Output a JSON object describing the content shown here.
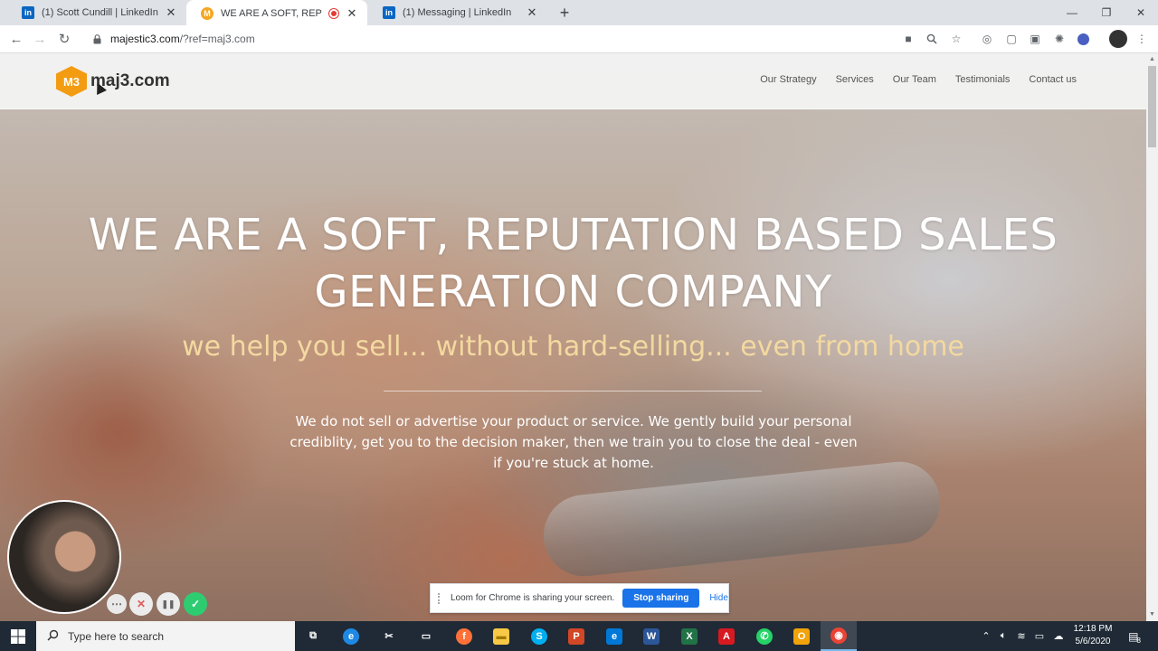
{
  "browser": {
    "tabs": [
      {
        "title": "(1) Scott Cundill | LinkedIn",
        "favicon": "linkedin-icon",
        "active": false
      },
      {
        "title": "WE ARE A SOFT, REPUTATIO",
        "favicon": "maj3-icon",
        "active": true,
        "recording": true
      },
      {
        "title": "(1) Messaging | LinkedIn",
        "favicon": "linkedin-icon",
        "active": false
      }
    ],
    "tab_close_glyph": "✕",
    "new_tab_glyph": "+",
    "window_controls": {
      "minimize": "—",
      "maximize": "❐",
      "close": "✕"
    },
    "address": {
      "host": "majestic3.com",
      "path": "/?ref=maj3.com"
    },
    "nav": {
      "back": "←",
      "forward": "→",
      "reload": "↻"
    }
  },
  "site": {
    "logo_text": "maj3.com",
    "logo_mark": "M3",
    "nav": [
      "Our Strategy",
      "Services",
      "Our Team",
      "Testimonials",
      "Contact us"
    ],
    "hero": {
      "title_line1": "WE ARE A SOFT, REPUTATION BASED SALES",
      "title_line2": "GENERATION COMPANY",
      "subtitle": "we help you sell... without hard-selling... even from home",
      "body": "We do not sell or advertise your product or service. We gently build your personal crediblity, get you to the decision maker, then we train you to close the deal - even if you're stuck at home."
    }
  },
  "loom": {
    "share_message": "Loom for Chrome is sharing your screen.",
    "stop_label": "Stop sharing",
    "hide_label": "Hide",
    "controls": {
      "more": "⋯",
      "cancel": "✕",
      "pause": "❚❚",
      "done": "✓"
    }
  },
  "taskbar": {
    "search_placeholder": "Type here to search",
    "time": "12:18 PM",
    "date": "5/6/2020",
    "notification_count": "8",
    "apps": [
      {
        "name": "task-view",
        "glyph": "⧉",
        "color": "#1f2a36"
      },
      {
        "name": "edge-chromium",
        "glyph": "e",
        "color": "#1e88e5"
      },
      {
        "name": "snip",
        "glyph": "✂",
        "color": "#1f2a36"
      },
      {
        "name": "remote-desktop",
        "glyph": "▭",
        "color": "#1f2a36"
      },
      {
        "name": "firefox",
        "glyph": "f",
        "color": "#ff7139"
      },
      {
        "name": "file-explorer",
        "glyph": "▬",
        "color": "#f9c846"
      },
      {
        "name": "skype",
        "glyph": "S",
        "color": "#00aff0"
      },
      {
        "name": "powerpoint",
        "glyph": "P",
        "color": "#d24726"
      },
      {
        "name": "edge-legacy",
        "glyph": "e",
        "color": "#0078d7"
      },
      {
        "name": "word",
        "glyph": "W",
        "color": "#2b579a"
      },
      {
        "name": "excel",
        "glyph": "X",
        "color": "#217346"
      },
      {
        "name": "acrobat",
        "glyph": "A",
        "color": "#d71920"
      },
      {
        "name": "whatsapp",
        "glyph": "✆",
        "color": "#25d366"
      },
      {
        "name": "outlook",
        "glyph": "O",
        "color": "#f0a30a"
      },
      {
        "name": "chrome",
        "glyph": "◉",
        "color": "#ea4335"
      }
    ]
  },
  "colors": {
    "accent": "#1a73e8",
    "logo": "#f39c12",
    "subtitle": "#f3d9a0",
    "taskbar": "#1f2a36"
  }
}
